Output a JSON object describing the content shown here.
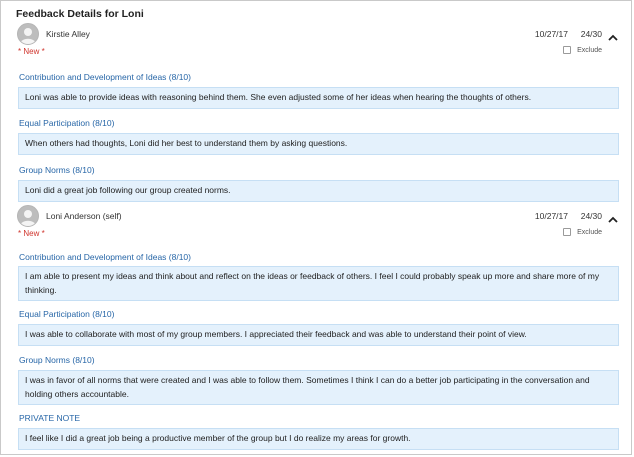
{
  "panel": {
    "title": "Feedback Details for Loni"
  },
  "reviews": [
    {
      "reviewer": "Kirstie Alley",
      "date": "10/27/17",
      "score": "24/30",
      "new_label": "* New *",
      "exclude_label": "Exclude",
      "sections": [
        {
          "label": "Contribution and Development of Ideas (8/10)",
          "comment": "Loni was able to provide ideas with reasoning behind them. She even adjusted some of her ideas when hearing the thoughts of others."
        },
        {
          "label": "Equal Participation (8/10)",
          "comment": "When others had thoughts, Loni did her best to understand them by asking questions."
        },
        {
          "label": "Group Norms (8/10)",
          "comment": "Loni did a great job following our group created norms."
        }
      ]
    },
    {
      "reviewer": "Loni Anderson (self)",
      "date": "10/27/17",
      "score": "24/30",
      "new_label": "* New *",
      "exclude_label": "Exclude",
      "sections": [
        {
          "label": "Contribution and Development of Ideas (8/10)",
          "comment": "I am able to present my ideas and think about and reflect on the ideas or feedback of others. I feel I could probably speak up more and share more of my thinking."
        },
        {
          "label": "Equal Participation (8/10)",
          "comment": "I was able to collaborate with most of my group members. I appreciated their feedback and was able to understand their point of view."
        },
        {
          "label": "Group Norms (8/10)",
          "comment": "I was in favor of all norms that were created and I was able to follow them. Sometimes I think I can do a better job participating in the conversation and holding others accountable."
        },
        {
          "label": "PRIVATE NOTE",
          "comment": "I feel like I did a great job being a productive member of the group but I do realize my areas for growth."
        }
      ]
    }
  ]
}
